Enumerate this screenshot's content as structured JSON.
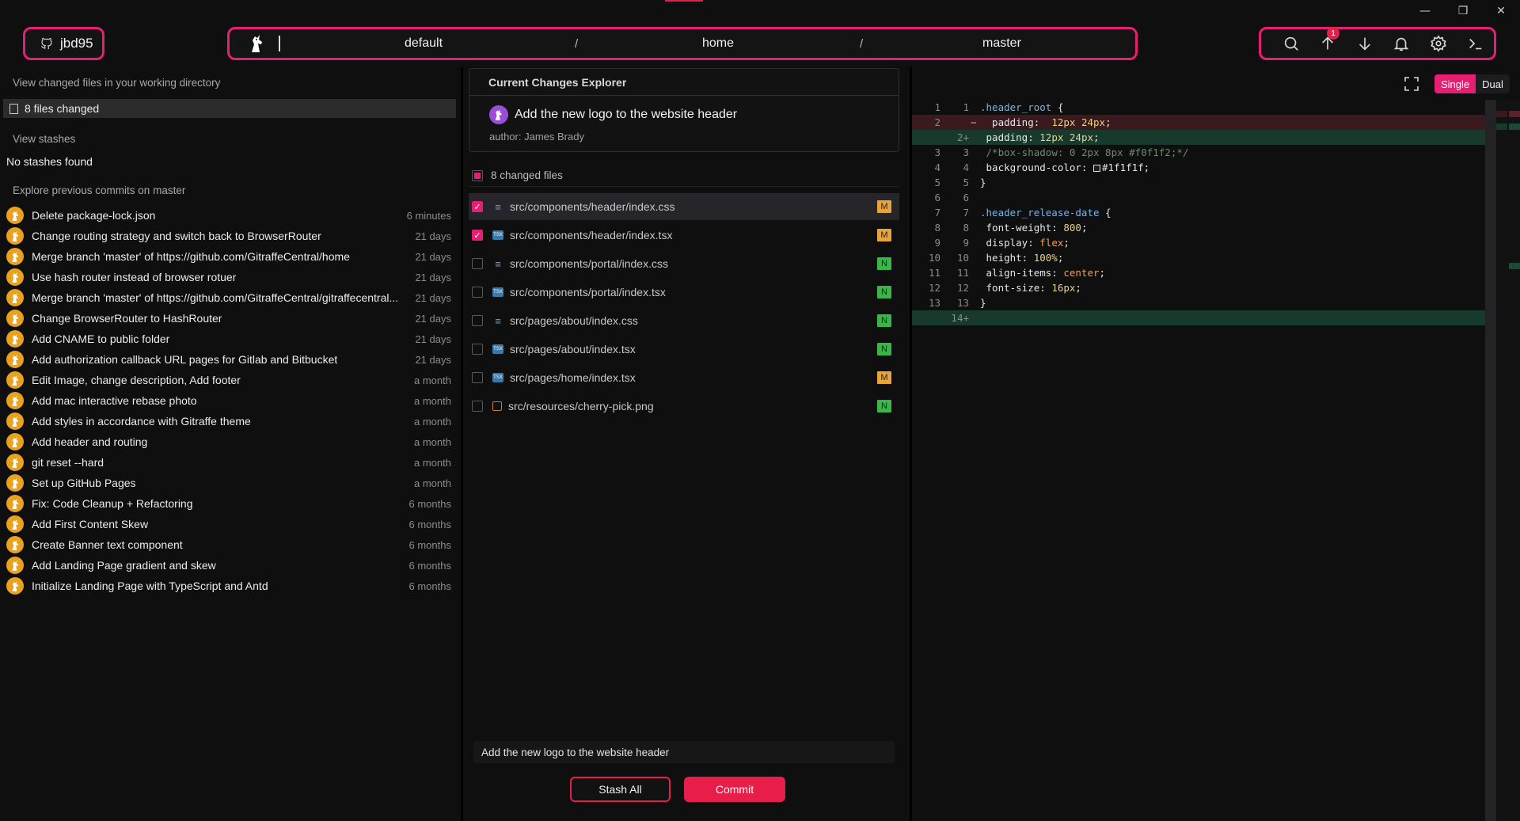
{
  "window": {
    "controls": [
      "—",
      "❐",
      "✕"
    ]
  },
  "header": {
    "username": "jbd95",
    "breadcrumbs": [
      "default",
      "home",
      "master"
    ],
    "separator": "/",
    "upload_badge": "1"
  },
  "left": {
    "changed_title": "View changed files in your working directory",
    "changed_count": "8 files changed",
    "stashes_title": "View stashes",
    "no_stashes": "No stashes found",
    "commits_title": "Explore previous commits on master",
    "commits": [
      {
        "msg": "Delete package-lock.json",
        "time": "6 minutes"
      },
      {
        "msg": "Change routing strategy and switch back to BrowserRouter",
        "time": "21 days"
      },
      {
        "msg": "Merge branch 'master' of https://github.com/GitraffeCentral/home",
        "time": "21 days"
      },
      {
        "msg": "Use hash router instead of browser rotuer",
        "time": "21 days"
      },
      {
        "msg": "Merge branch 'master' of https://github.com/GitraffeCentral/gitraffecentral...",
        "time": "21 days"
      },
      {
        "msg": "Change BrowserRouter to HashRouter",
        "time": "21 days"
      },
      {
        "msg": "Add CNAME to public folder",
        "time": "21 days"
      },
      {
        "msg": "Add authorization callback URL pages for Gitlab and Bitbucket",
        "time": "21 days"
      },
      {
        "msg": "Edit Image, change description, Add footer",
        "time": "a month"
      },
      {
        "msg": "Add mac interactive rebase photo",
        "time": "a month"
      },
      {
        "msg": "Add styles in accordance with Gitraffe theme",
        "time": "a month"
      },
      {
        "msg": "Add header and routing",
        "time": "a month"
      },
      {
        "msg": "git reset --hard",
        "time": "a month"
      },
      {
        "msg": "Set up GitHub Pages",
        "time": "a month"
      },
      {
        "msg": "Fix: Code Cleanup + Refactoring",
        "time": "6 months"
      },
      {
        "msg": "Add First Content Skew",
        "time": "6 months"
      },
      {
        "msg": "Create Banner text component",
        "time": "6 months"
      },
      {
        "msg": "Add Landing Page gradient and skew",
        "time": "6 months"
      },
      {
        "msg": "Initialize Landing Page with TypeScript and Antd",
        "time": "6 months"
      }
    ]
  },
  "explorer": {
    "heading": "Current Changes Explorer",
    "title": "Add the new logo to the website header",
    "author": "author: James Brady",
    "files_header": "8 changed files",
    "files": [
      {
        "path": "src/components/header/index.css",
        "type": "css",
        "status": "M",
        "checked": true
      },
      {
        "path": "src/components/header/index.tsx",
        "type": "tsx",
        "status": "M",
        "checked": true
      },
      {
        "path": "src/components/portal/index.css",
        "type": "css",
        "status": "N",
        "checked": false
      },
      {
        "path": "src/components/portal/index.tsx",
        "type": "tsx",
        "status": "N",
        "checked": false
      },
      {
        "path": "src/pages/about/index.css",
        "type": "css",
        "status": "N",
        "checked": false
      },
      {
        "path": "src/pages/about/index.tsx",
        "type": "tsx",
        "status": "N",
        "checked": false
      },
      {
        "path": "src/pages/home/index.tsx",
        "type": "tsx",
        "status": "M",
        "checked": false
      },
      {
        "path": "src/resources/cherry-pick.png",
        "type": "png",
        "status": "N",
        "checked": false
      }
    ],
    "commit_message": "Add the new logo to the website header",
    "stash_label": "Stash All",
    "commit_label": "Commit"
  },
  "diff": {
    "view_single": "Single",
    "view_dual": "Dual",
    "lines": [
      {
        "l": "1",
        "r": "1",
        "mark": "",
        "kind": "",
        "html": "<span class=\"sel\">.header_root</span> {"
      },
      {
        "l": "2",
        "r": "",
        "mark": "−",
        "kind": "del",
        "html": "  padding:  <span class=\"num\">12px 24px</span>;"
      },
      {
        "l": "",
        "r": "2+",
        "mark": "",
        "kind": "add",
        "html": " padding: <span class=\"num\">12px 24px</span>;"
      },
      {
        "l": "3",
        "r": "3",
        "mark": "",
        "kind": "",
        "html": " <span class=\"cm\">/*box-shadow: 0 2px 8px #f0f1f2;*/</span>"
      },
      {
        "l": "4",
        "r": "4",
        "mark": "",
        "kind": "",
        "html": " background-color: <span class=\"swatch\"></span>#1f1f1f;"
      },
      {
        "l": "5",
        "r": "5",
        "mark": "",
        "kind": "",
        "html": "}"
      },
      {
        "l": "6",
        "r": "6",
        "mark": "",
        "kind": "",
        "html": ""
      },
      {
        "l": "7",
        "r": "7",
        "mark": "",
        "kind": "",
        "html": "<span class=\"sel\">.header_release-date</span> {"
      },
      {
        "l": "8",
        "r": "8",
        "mark": "",
        "kind": "",
        "html": " font-weight: <span class=\"num\">800</span>;"
      },
      {
        "l": "9",
        "r": "9",
        "mark": "",
        "kind": "",
        "html": " display: <span class=\"kw\">flex</span>;"
      },
      {
        "l": "10",
        "r": "10",
        "mark": "",
        "kind": "",
        "html": " height: <span class=\"num\">100%</span>;"
      },
      {
        "l": "11",
        "r": "11",
        "mark": "",
        "kind": "",
        "html": " align-items: <span class=\"kw\">center</span>;"
      },
      {
        "l": "12",
        "r": "12",
        "mark": "",
        "kind": "",
        "html": " font-size: <span class=\"num\">16px</span>;"
      },
      {
        "l": "13",
        "r": "13",
        "mark": "",
        "kind": "",
        "html": "}"
      },
      {
        "l": "",
        "r": "14+",
        "mark": "",
        "kind": "add",
        "html": ""
      }
    ]
  },
  "colors": {
    "accent": "#e81e73",
    "danger": "#e81e4a",
    "modified": "#e8a43c",
    "new": "#39b54a"
  }
}
